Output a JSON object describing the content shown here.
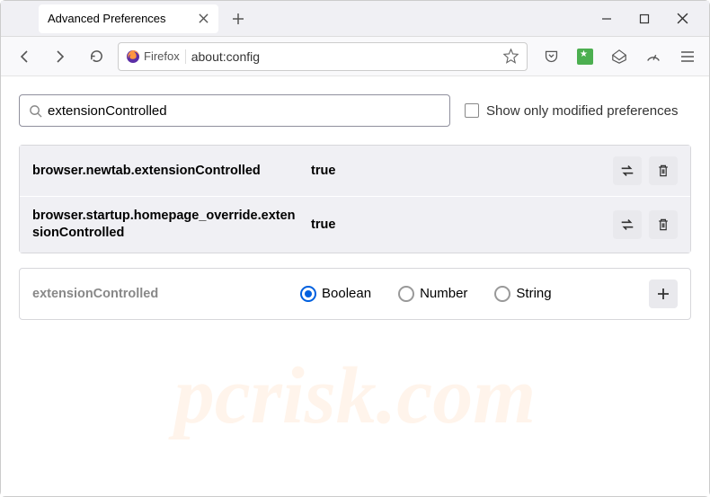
{
  "tab": {
    "title": "Advanced Preferences"
  },
  "urlbar": {
    "app_label": "Firefox",
    "url": "about:config"
  },
  "search": {
    "value": "extensionControlled",
    "checkbox_label": "Show only modified preferences"
  },
  "prefs": [
    {
      "name": "browser.newtab.extensionControlled",
      "value": "true"
    },
    {
      "name": "browser.startup.homepage_override.extensionControlled",
      "value": "true"
    }
  ],
  "custom": {
    "name": "extensionControlled",
    "types": [
      "Boolean",
      "Number",
      "String"
    ],
    "selected": "Boolean"
  },
  "watermark": "pcrisk.com"
}
